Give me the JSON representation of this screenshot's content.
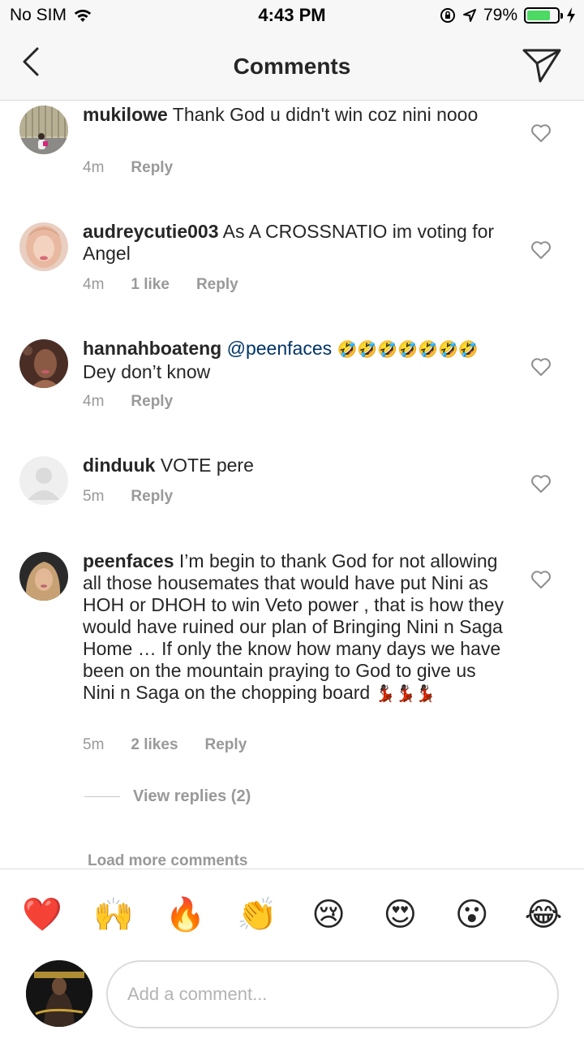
{
  "status_bar": {
    "carrier": "No SIM",
    "time": "4:43 PM",
    "battery_percent": "79%",
    "battery_level": 0.79,
    "battery_color": "#4cd964"
  },
  "header": {
    "title": "Comments",
    "back_icon": "chevron-left-icon",
    "send_icon": "paper-plane-icon"
  },
  "comments": [
    {
      "username": "mukilowe",
      "text": "Thank God u didn't win coz nini nooo",
      "time": "4m",
      "reply": "Reply"
    },
    {
      "username": "audreycutie003",
      "text": "As A CROSSNATIO im voting for Angel",
      "time": "4m",
      "likes": "1 like",
      "reply": "Reply"
    },
    {
      "username": "hannahboateng",
      "mention": "@peenfaces",
      "text_emoji": "🤣🤣🤣🤣🤣🤣🤣",
      "text": "Dey don’t know",
      "time": "4m",
      "reply": "Reply"
    },
    {
      "username": "dinduuk",
      "text": "VOTE pere",
      "time": "5m",
      "reply": "Reply"
    },
    {
      "username": "peenfaces",
      "text": "I’m begin to thank God for not allowing all those housemates that would have put Nini as HOH or DHOH to win Veto power , that is how they would have ruined our plan of Bringing Nini n Saga Home … If only the know how many days we have been on the mountain praying to God to give us Nini n Saga on the chopping board",
      "text_emoji": "💃🏿💃🏿💃🏿",
      "time": "5m",
      "likes": "2 likes",
      "reply": "Reply"
    }
  ],
  "view_replies": "View replies (2)",
  "load_more": "Load more comments",
  "emoji_bar": [
    "❤️",
    "🙌",
    "🔥",
    "👏",
    "😢",
    "😍",
    "😮",
    "😂"
  ],
  "composer": {
    "placeholder": "Add a comment..."
  }
}
